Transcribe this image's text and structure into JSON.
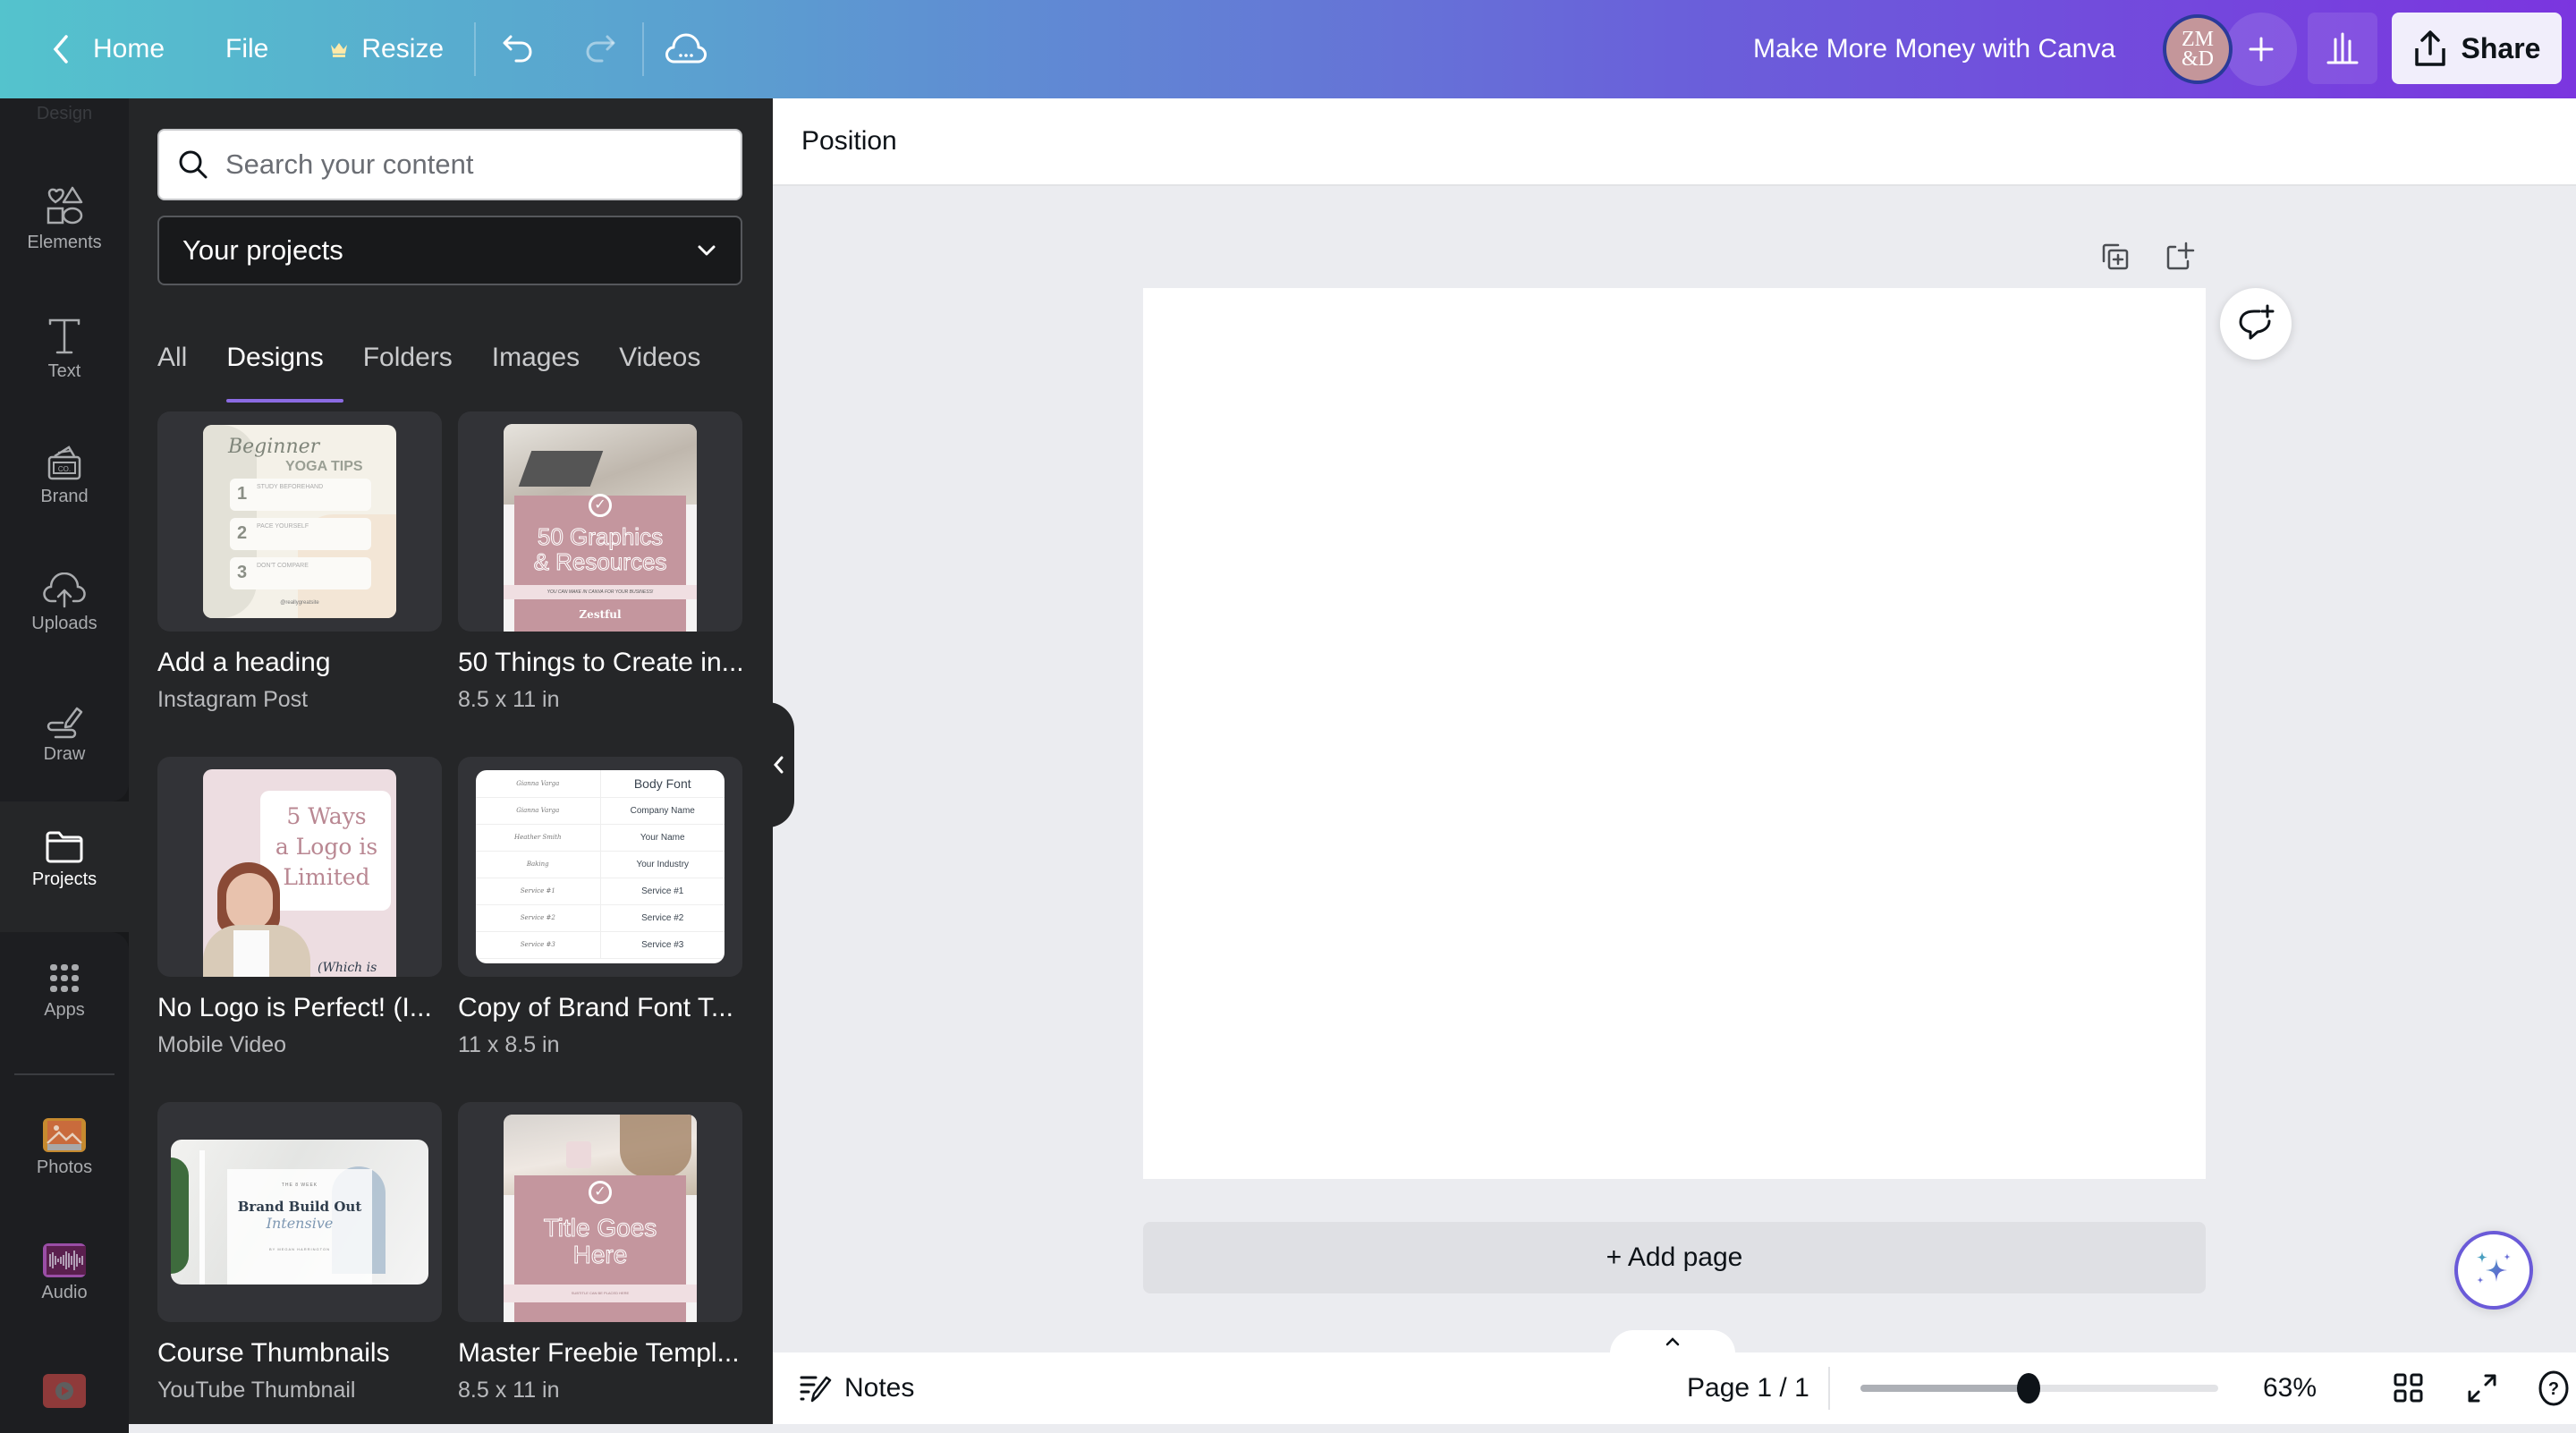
{
  "topbar": {
    "home_label": "Home",
    "file_label": "File",
    "resize_label": "Resize",
    "document_title": "Make More Money with Canva",
    "avatar_initials_line1": "ZM",
    "avatar_initials_line2": "&D",
    "share_label": "Share"
  },
  "rail": {
    "items": [
      {
        "label": "Design",
        "icon": "design-icon"
      },
      {
        "label": "Elements",
        "icon": "elements-icon"
      },
      {
        "label": "Text",
        "icon": "text-icon"
      },
      {
        "label": "Brand",
        "icon": "brand-icon"
      },
      {
        "label": "Uploads",
        "icon": "uploads-icon"
      },
      {
        "label": "Draw",
        "icon": "draw-icon"
      },
      {
        "label": "Projects",
        "icon": "folder-icon",
        "active": true
      },
      {
        "label": "Apps",
        "icon": "apps-icon"
      },
      {
        "label": "Photos",
        "icon": "photos-icon"
      },
      {
        "label": "Audio",
        "icon": "audio-icon"
      },
      {
        "label": "",
        "icon": "video-icon"
      }
    ]
  },
  "panel": {
    "search_placeholder": "Search your content",
    "select_value": "Your projects",
    "tabs": [
      {
        "label": "All"
      },
      {
        "label": "Designs",
        "active": true
      },
      {
        "label": "Folders"
      },
      {
        "label": "Images"
      },
      {
        "label": "Videos"
      }
    ],
    "designs": [
      {
        "title": "Add a heading",
        "subtitle": "Instagram Post",
        "thumb": {
          "script": "Beginner",
          "heading": "YOGA TIPS",
          "steps": [
            "STUDY BEFOREHAND",
            "PACE YOURSELF",
            "DON'T COMPARE"
          ],
          "footer": "@reallygreatsite"
        }
      },
      {
        "title": "50 Things to Create in...",
        "subtitle": "8.5 x 11 in",
        "thumb": {
          "line1": "50 Graphics",
          "line2": "& Resources",
          "band": "YOU CAN MAKE IN CANVA FOR YOUR BUSINESS!",
          "brand": "Zestful"
        }
      },
      {
        "title": "No Logo is Perfect! (I...",
        "subtitle": "Mobile Video",
        "thumb": {
          "line1": "5 Ways",
          "line2": "a Logo is",
          "line3": "Limited",
          "bottom": "(Which is"
        }
      },
      {
        "title": "Copy of  Brand Font T...",
        "subtitle": "11 x 8.5 in",
        "thumb": {
          "rows": [
            [
              "Gianna Varga",
              "Body Font"
            ],
            [
              "Gianna Varga",
              "Company Name"
            ],
            [
              "Heather Smith",
              "Your Name"
            ],
            [
              "Baking",
              "Your Industry"
            ],
            [
              "Service #1",
              "Service #1"
            ],
            [
              "Service #2",
              "Service #2"
            ],
            [
              "Service #3",
              "Service #3"
            ]
          ]
        }
      },
      {
        "title": "Course Thumbnails",
        "subtitle": "YouTube Thumbnail",
        "thumb": {
          "kicker": "THE 8 WEEK",
          "heading": "Brand Build Out",
          "script": "Intensive",
          "byline": "BY MEGAN HARRINGTON"
        }
      },
      {
        "title": "Master Freebie Templ...",
        "subtitle": "8.5 x 11 in",
        "thumb": {
          "line1": "Title Goes",
          "line2": "Here",
          "band": "SUBTITLE CAN BE PLACED HERE"
        }
      }
    ]
  },
  "context_toolbar": {
    "position_label": "Position"
  },
  "canvas": {
    "add_page_label": "+ Add page"
  },
  "footer": {
    "notes_label": "Notes",
    "page_indicator": "Page 1 / 1",
    "zoom_value": "63%",
    "zoom_fraction": 0.47
  },
  "colors": {
    "accent": "#8b6be3",
    "panel_bg": "#252628",
    "rail_bg": "#1d1e21",
    "thumb_pink": "#c4969e"
  }
}
